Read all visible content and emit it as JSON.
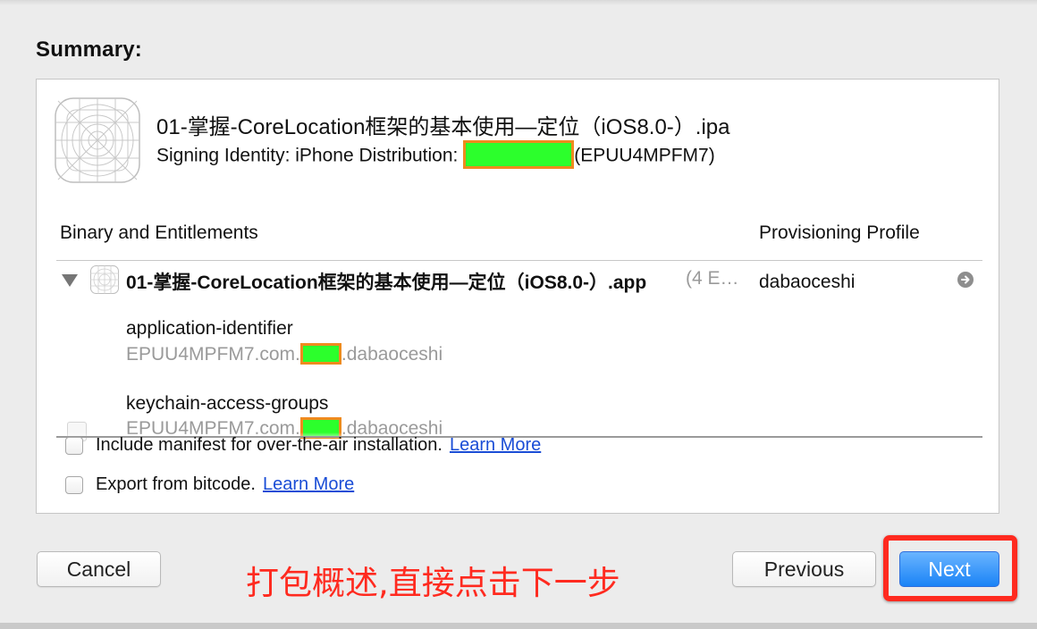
{
  "dialog": {
    "summary_title": "Summary:"
  },
  "summary": {
    "ipa_name": "01-掌握-CoreLocation框架的基本使用—定位（iOS8.0-）.ipa",
    "signing_label": "Signing Identity: iPhone Distribution: ",
    "signing_id_suffix": "(EPUU4MPFM7)",
    "table": {
      "col_binary": "Binary and Entitlements",
      "col_profile": "Provisioning Profile",
      "app_name": "01-掌握-CoreLocation框架的基本使用—定位（iOS8.0-）.app",
      "app_count": "(4 E…",
      "profile_value": "dabaoceshi",
      "entitlements": [
        {
          "key": "application-identifier",
          "value_prefix": "EPUU4MPFM7.com.",
          "value_suffix": ".dabaoceshi"
        },
        {
          "key": "keychain-access-groups",
          "value_prefix": "EPUU4MPFM7.com.",
          "value_suffix": ".dabaoceshi"
        }
      ]
    },
    "options": {
      "manifest_label": "Include manifest for over-the-air installation.",
      "manifest_link": "Learn More",
      "bitcode_label": "Export from bitcode.",
      "bitcode_link": "Learn More",
      "manifest_checked": false,
      "bitcode_checked": false
    }
  },
  "buttons": {
    "cancel": "Cancel",
    "previous": "Previous",
    "next": "Next"
  },
  "annotation": "打包概述,直接点击下一步",
  "colors": {
    "annotation": "#ff2a1f",
    "redaction_fill": "#2cff2c",
    "redaction_border": "#ef8a1e",
    "link": "#1a4dd6",
    "next_button": "#1a83f6"
  },
  "icons": {
    "app_icon": "app-icon-template",
    "disclosure": "disclosure-triangle-down-icon",
    "go": "arrow-circle-right-icon"
  }
}
